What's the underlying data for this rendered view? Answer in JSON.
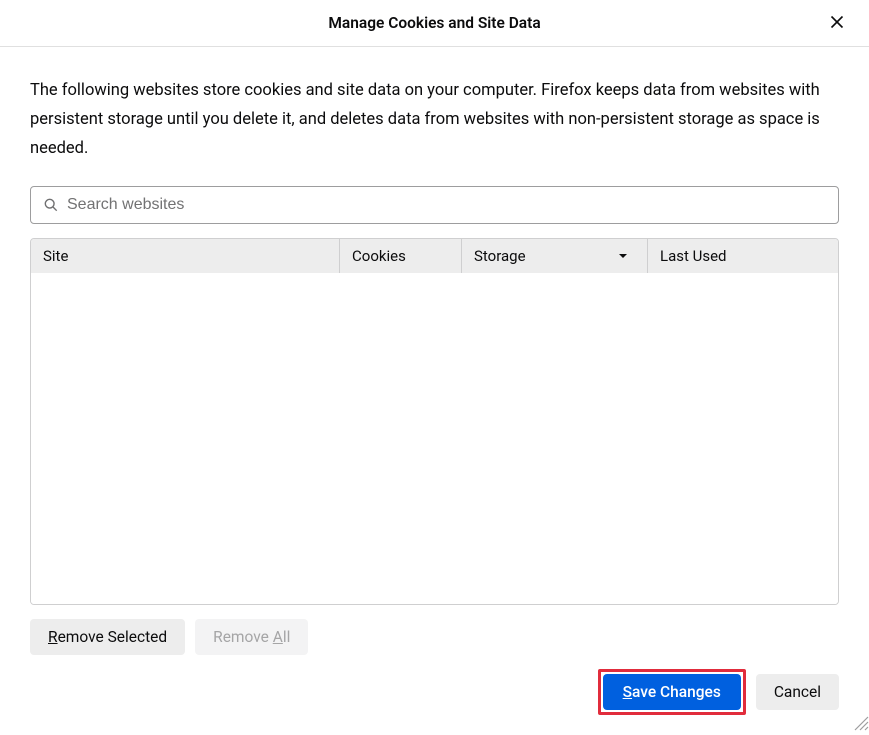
{
  "dialog": {
    "title": "Manage Cookies and Site Data",
    "description": "The following websites store cookies and site data on your computer. Firefox keeps data from websites with persistent storage until you delete it, and deletes data from websites with non-persistent storage as space is needed."
  },
  "search": {
    "placeholder": "Search websites",
    "value": ""
  },
  "table": {
    "headers": {
      "site": "Site",
      "cookies": "Cookies",
      "storage": "Storage",
      "last_used": "Last Used"
    },
    "sort_column": "storage",
    "sort_direction": "desc",
    "rows": []
  },
  "buttons": {
    "remove_selected_prefix": "R",
    "remove_selected_rest": "emove Selected",
    "remove_all_prefix": "R",
    "remove_all_rest": "emove ",
    "remove_all_mnemonic": "A",
    "remove_all_tail": "ll",
    "save_prefix": "S",
    "save_rest": "ave Changes",
    "cancel": "Cancel"
  }
}
